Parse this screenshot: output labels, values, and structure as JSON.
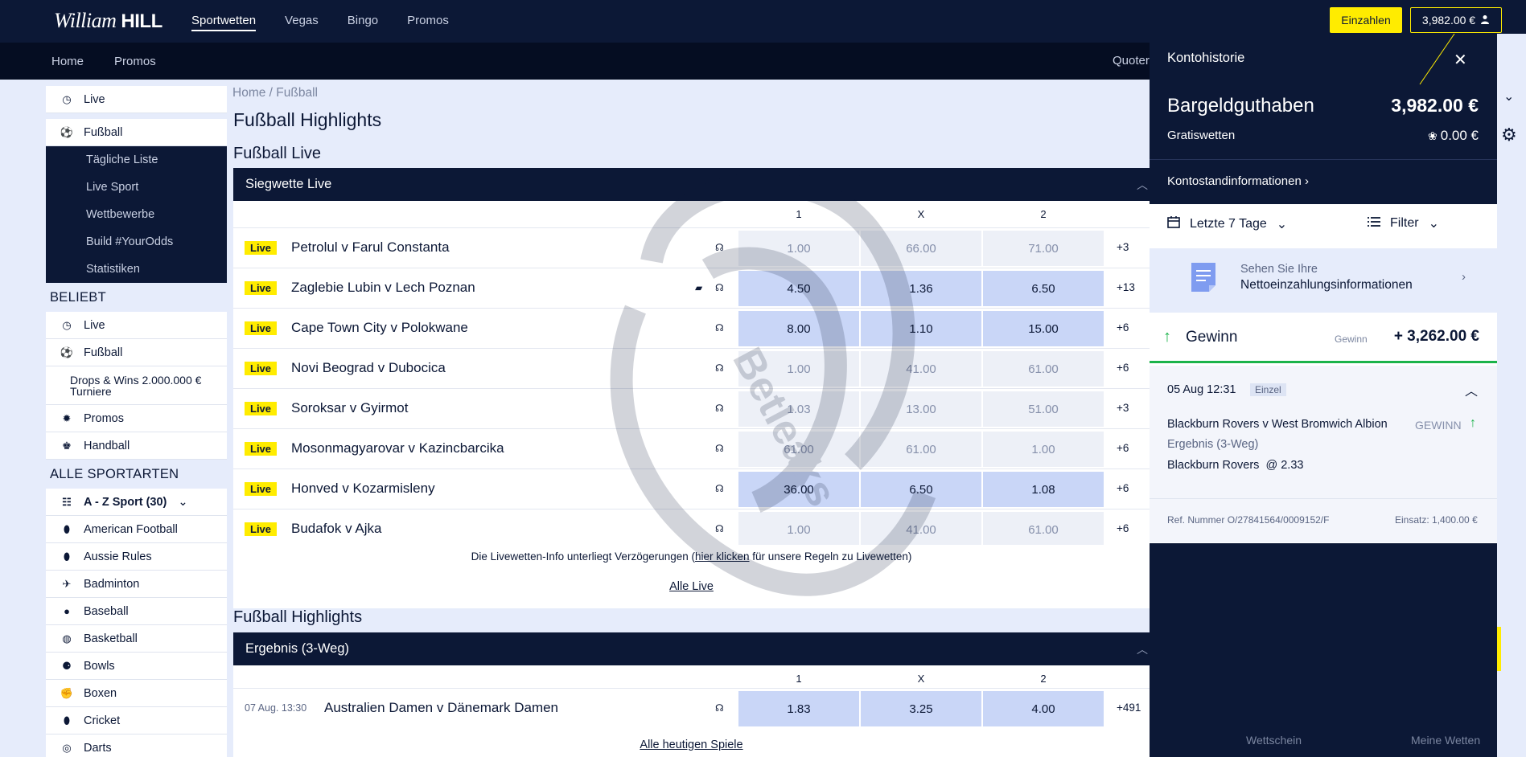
{
  "header": {
    "logo_script": "William",
    "logo_bold": "HILL",
    "nav": [
      "Sportwetten",
      "Vegas",
      "Bingo",
      "Promos"
    ],
    "deposit_label": "Einzahlen",
    "balance_label": "3,982.00 €"
  },
  "subnav": {
    "items": [
      "Home",
      "Promos"
    ],
    "odds_label": "Quoter"
  },
  "sidebar": {
    "top_items": [
      {
        "label": "Live",
        "icon": "clock-icon"
      },
      {
        "label": "Fußball",
        "icon": "soccer-ball-icon"
      }
    ],
    "sub_items": [
      "Tägliche Liste",
      "Live Sport",
      "Wettbewerbe",
      "Build #YourOdds",
      "Statistiken"
    ],
    "popular_heading": "BELIEBT",
    "popular_items": [
      {
        "label": "Live",
        "icon": "clock-icon"
      },
      {
        "label": "Fußball",
        "icon": "soccer-ball-icon"
      },
      {
        "label": "Drops & Wins 2.000.000 € Turniere",
        "icon": ""
      },
      {
        "label": "Promos",
        "icon": "gear-badge-icon"
      },
      {
        "label": "Handball",
        "icon": "handball-icon"
      }
    ],
    "all_heading": "ALLE SPORTARTEN",
    "az_label": "A - Z Sport (30)",
    "sports": [
      "American Football",
      "Aussie Rules",
      "Badminton",
      "Baseball",
      "Basketball",
      "Bowls",
      "Boxen",
      "Cricket",
      "Darts"
    ]
  },
  "main": {
    "breadcrumb": [
      "Home",
      "Fußball"
    ],
    "title": "Fußball Highlights",
    "live_section": {
      "title": "Fußball Live",
      "market": "Siegwette Live",
      "cols": [
        "1",
        "X",
        "2"
      ],
      "badge": "Live",
      "matches": [
        {
          "name": "Petrolul v Farul Constanta",
          "odds": [
            "1.00",
            "66.00",
            "71.00"
          ],
          "active": [
            false,
            false,
            false
          ],
          "more": "+3",
          "tv": false
        },
        {
          "name": "Zaglebie Lubin v Lech Poznan",
          "odds": [
            "4.50",
            "1.36",
            "6.50"
          ],
          "active": [
            true,
            true,
            true
          ],
          "more": "+13",
          "tv": true
        },
        {
          "name": "Cape Town City v Polokwane",
          "odds": [
            "8.00",
            "1.10",
            "15.00"
          ],
          "active": [
            true,
            true,
            true
          ],
          "more": "+6",
          "tv": false
        },
        {
          "name": "Novi Beograd v Dubocica",
          "odds": [
            "1.00",
            "41.00",
            "61.00"
          ],
          "active": [
            false,
            false,
            false
          ],
          "more": "+6",
          "tv": false
        },
        {
          "name": "Soroksar v Gyirmot",
          "odds": [
            "1.03",
            "13.00",
            "51.00"
          ],
          "active": [
            false,
            false,
            false
          ],
          "more": "+3",
          "tv": false
        },
        {
          "name": "Mosonmagyarovar v Kazincbarcika",
          "odds": [
            "61.00",
            "61.00",
            "1.00"
          ],
          "active": [
            false,
            false,
            false
          ],
          "more": "+6",
          "tv": false
        },
        {
          "name": "Honved v Kozarmisleny",
          "odds": [
            "36.00",
            "6.50",
            "1.08"
          ],
          "active": [
            true,
            true,
            true
          ],
          "more": "+6",
          "tv": false
        },
        {
          "name": "Budafok v Ajka",
          "odds": [
            "1.00",
            "41.00",
            "61.00"
          ],
          "active": [
            false,
            false,
            false
          ],
          "more": "+6",
          "tv": false
        }
      ],
      "info_pre": "Die Livewetten-Info unterliegt Verzögerungen (",
      "info_link": "hier klicken",
      "info_post": " für unsere Regeln zu Livewetten)",
      "all_live": "Alle Live"
    },
    "highlights_section": {
      "title": "Fußball Highlights",
      "market": "Ergebnis (3-Weg)",
      "cols": [
        "1",
        "X",
        "2"
      ],
      "match": {
        "time": "07 Aug. 13:30",
        "name": "Australien Damen v Dänemark Damen",
        "odds": [
          "1.83",
          "3.25",
          "4.00"
        ],
        "more": "+491"
      },
      "all_today": "Alle heutigen Spiele"
    },
    "watermark": "Betleaks"
  },
  "account_panel": {
    "title": "Kontohistorie",
    "cash_label": "Bargeldguthaben",
    "cash_value": "3,982.00 €",
    "free_label": "Gratiswetten",
    "free_value": "0.00 €",
    "account_info": "Kontostandinformationen",
    "period": "Letzte 7 Tage",
    "filter": "Filter",
    "net_line1": "Sehen Sie Ihre",
    "net_line2": "Nettoeinzahlungsinformationen",
    "win_label": "Gewinn",
    "win_small": "Gewinn",
    "win_value": "+ 3,262.00 €",
    "bet": {
      "date": "05 Aug 12:31",
      "type": "Einzel",
      "event": "Blackburn Rovers v West Bromwich Albion",
      "result": "GEWINN",
      "market": "Ergebnis (3-Weg)",
      "selection": "Blackburn Rovers  @ 2.33",
      "ref_label": "Ref. Nummer",
      "ref_value": "O/27841564/0009152/F",
      "stake": "Einsatz: 1,400.00 €"
    },
    "bottom_left": "Wettschein",
    "bottom_right": "Meine Wetten"
  }
}
